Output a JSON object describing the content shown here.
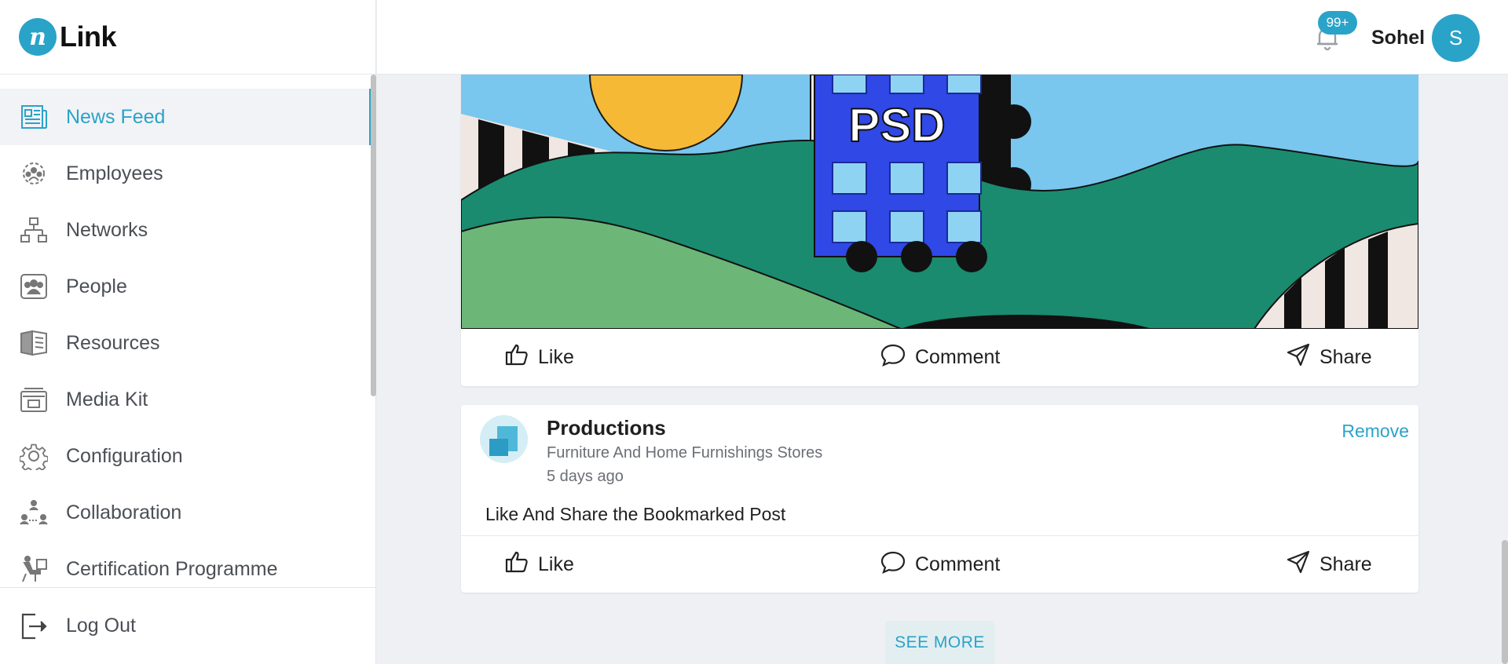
{
  "brand": {
    "logo_mark": "n",
    "name": "Link"
  },
  "sidebar": {
    "items": [
      {
        "label": "News Feed",
        "icon": "newspaper-icon",
        "active": true
      },
      {
        "label": "Employees",
        "icon": "employees-gear-icon"
      },
      {
        "label": "Networks",
        "icon": "network-icon"
      },
      {
        "label": "People",
        "icon": "people-icon"
      },
      {
        "label": "Resources",
        "icon": "book-icon"
      },
      {
        "label": "Media Kit",
        "icon": "media-kit-icon"
      },
      {
        "label": "Configuration",
        "icon": "gear-icon"
      },
      {
        "label": "Collaboration",
        "icon": "collaboration-icon"
      },
      {
        "label": "Certification Programme",
        "icon": "certification-icon"
      }
    ],
    "logout_label": "Log Out"
  },
  "header": {
    "notification_count": "99+",
    "username": "Sohel",
    "avatar_initial": "S"
  },
  "feed": {
    "post1": {
      "image_text": "PSD",
      "actions": {
        "like": "Like",
        "comment": "Comment",
        "share": "Share"
      }
    },
    "post2": {
      "title": "Productions",
      "category": "Furniture And Home Furnishings Stores",
      "time": "5 days ago",
      "remove_label": "Remove",
      "text": "Like And Share the Bookmarked Post",
      "actions": {
        "like": "Like",
        "comment": "Comment",
        "share": "Share"
      }
    },
    "see_more_label": "SEE MORE"
  },
  "colors": {
    "accent": "#2aa3c9",
    "background": "#eef0f3"
  }
}
